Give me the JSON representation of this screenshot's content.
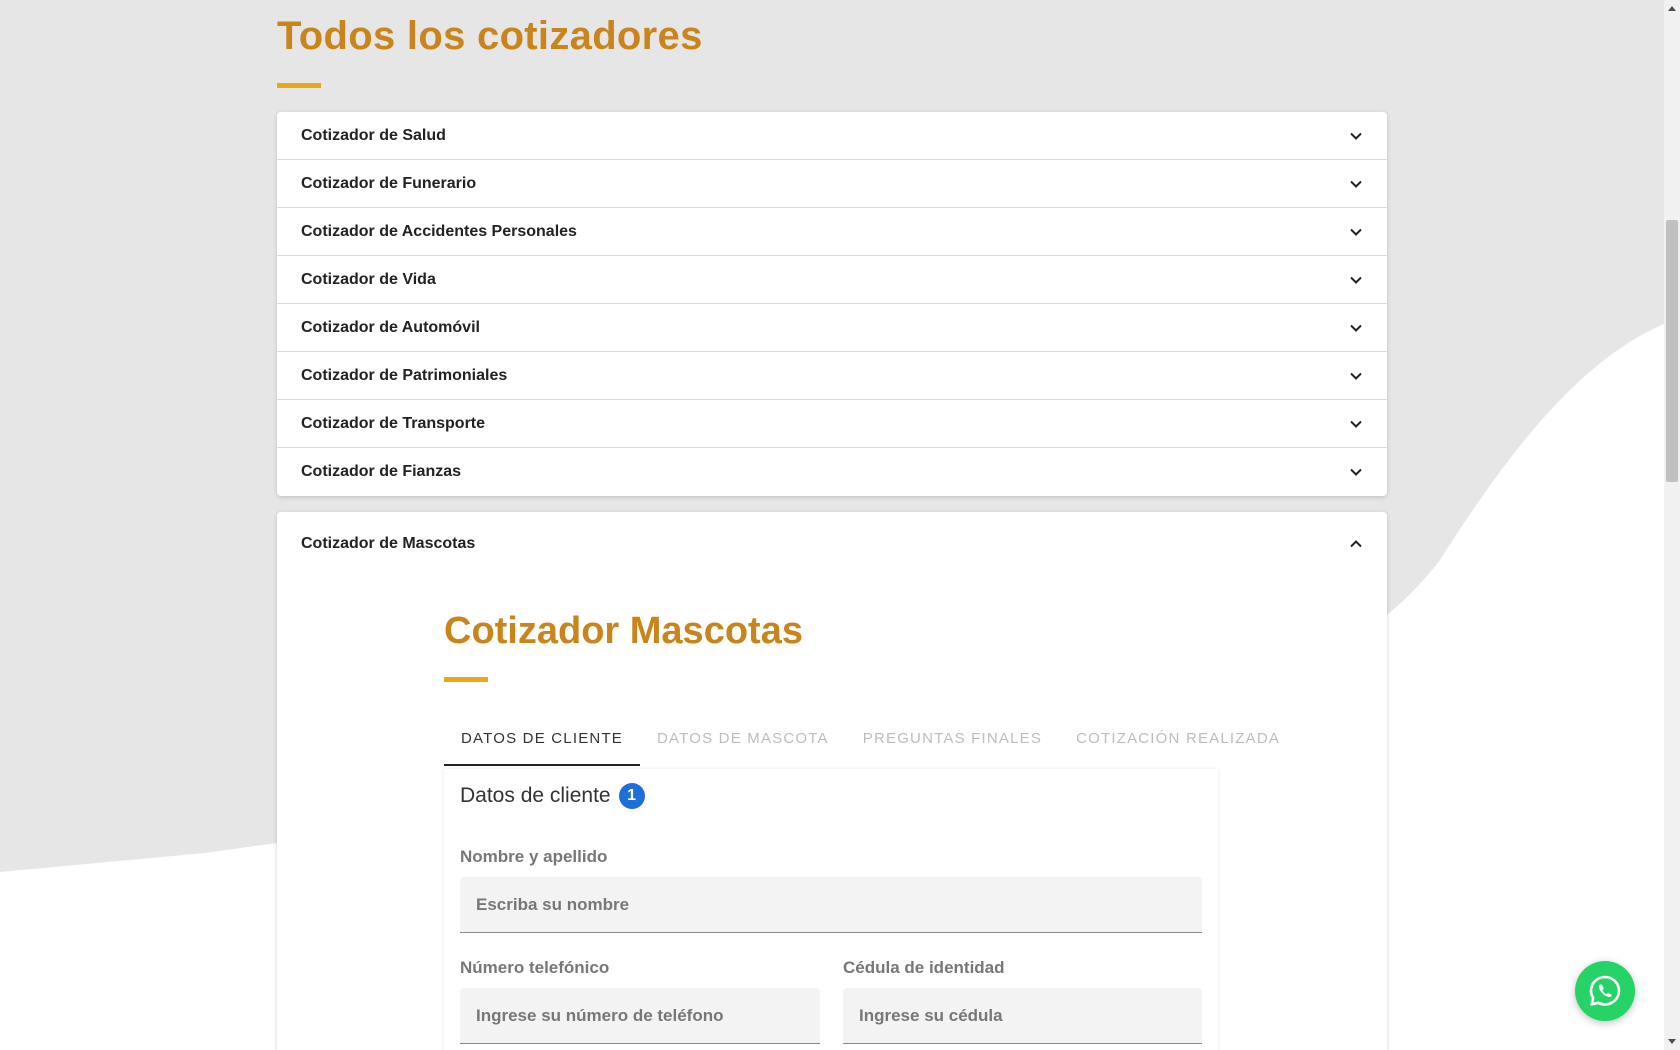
{
  "page": {
    "title": "Todos los cotizadores",
    "accent_color": "#c9851b",
    "bar_color": "#e8a817"
  },
  "accordion": {
    "items": [
      {
        "label": "Cotizador de Salud"
      },
      {
        "label": "Cotizador de Funerario"
      },
      {
        "label": "Cotizador de Accidentes Personales"
      },
      {
        "label": "Cotizador de Vida"
      },
      {
        "label": "Cotizador de Automóvil"
      },
      {
        "label": "Cotizador de Patrimoniales"
      },
      {
        "label": "Cotizador de Transporte"
      },
      {
        "label": "Cotizador de Fianzas"
      }
    ],
    "expanded": {
      "label": "Cotizador de Mascotas",
      "title": "Cotizador Mascotas"
    }
  },
  "tabs": [
    {
      "label": "DATOS DE CLIENTE",
      "active": true
    },
    {
      "label": "DATOS DE MASCOTA",
      "active": false
    },
    {
      "label": "PREGUNTAS FINALES",
      "active": false
    },
    {
      "label": "COTIZACIÓN REALIZADA",
      "active": false
    }
  ],
  "form": {
    "heading": "Datos de cliente",
    "step_number": "1",
    "name": {
      "label": "Nombre y apellido",
      "placeholder": "Escriba su nombre",
      "value": ""
    },
    "phone": {
      "label": "Número telefónico",
      "placeholder": "Ingrese su número de teléfono",
      "value": ""
    },
    "id_card": {
      "label": "Cédula de identidad",
      "placeholder": "Ingrese su cédula",
      "value": ""
    }
  },
  "whatsapp": {
    "icon": "whatsapp-icon",
    "color": "#25d366"
  }
}
